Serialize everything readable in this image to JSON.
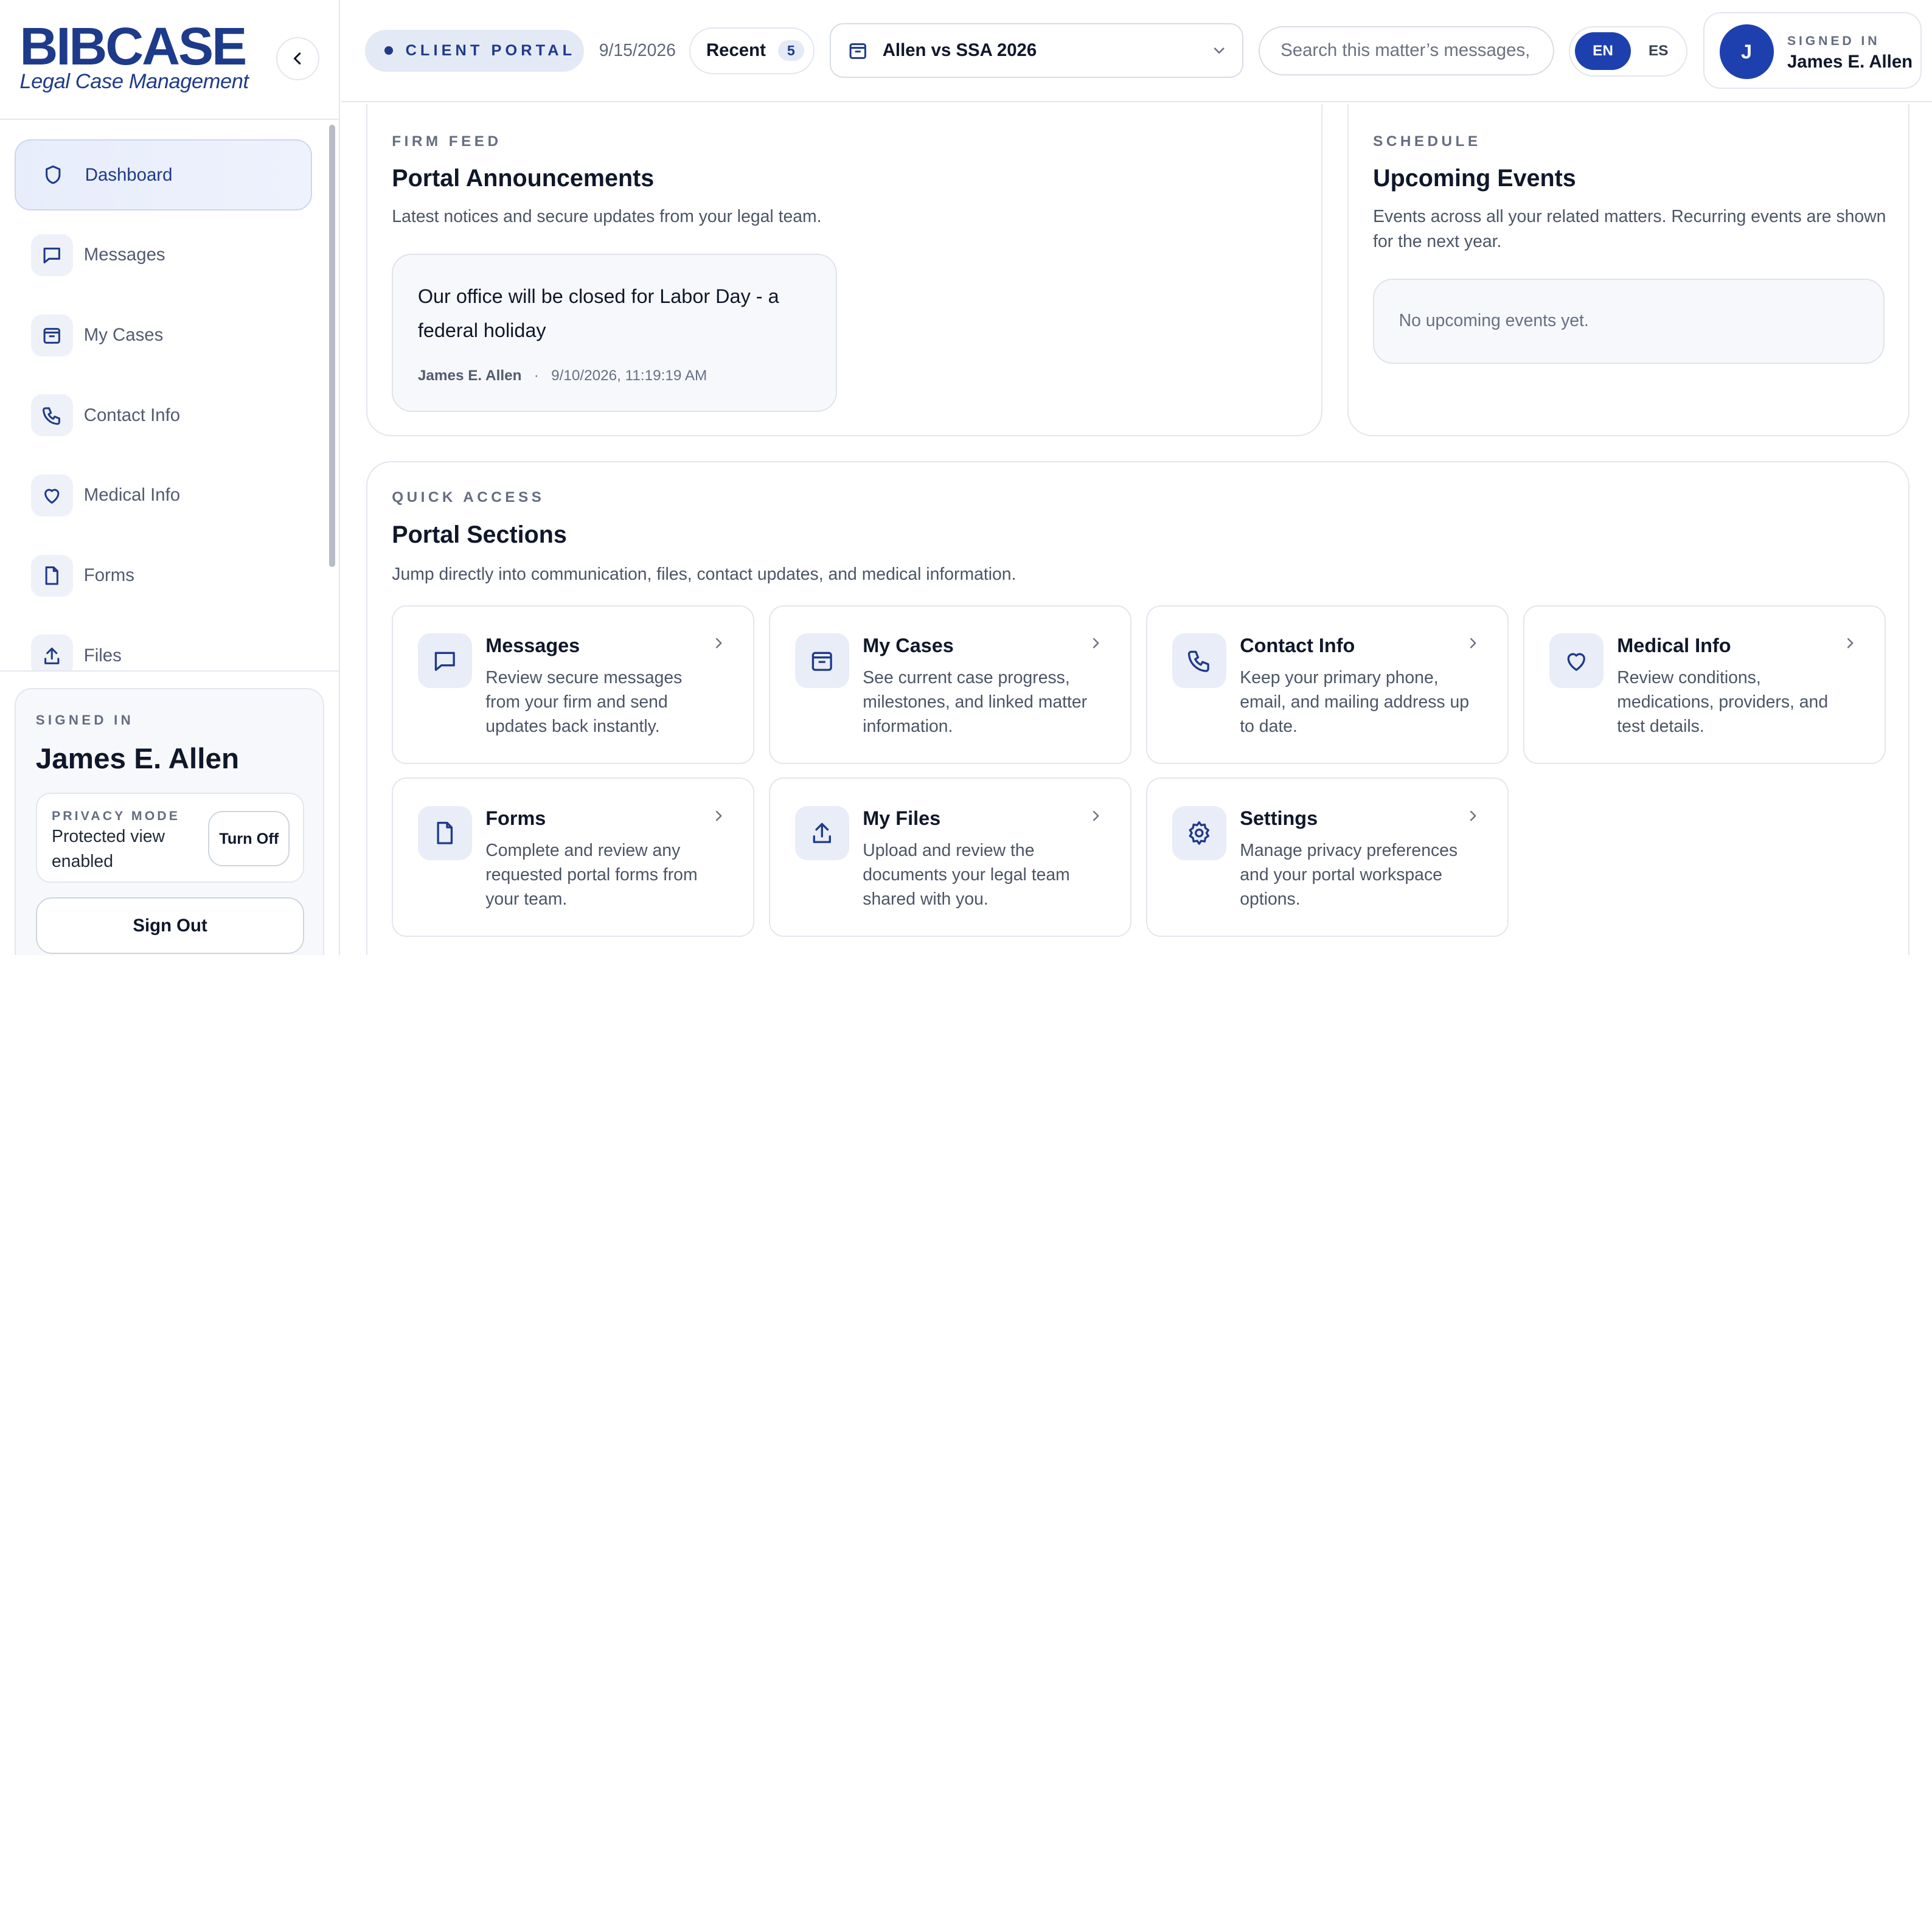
{
  "brand": {
    "logo_word": "BIBCASE",
    "tagline": "Legal Case Management"
  },
  "sidebar": {
    "items": [
      {
        "label": "Dashboard",
        "icon": "shield-icon",
        "active": true
      },
      {
        "label": "Messages",
        "icon": "message-icon"
      },
      {
        "label": "My Cases",
        "icon": "case-icon"
      },
      {
        "label": "Contact Info",
        "icon": "phone-icon"
      },
      {
        "label": "Medical Info",
        "icon": "heart-icon"
      },
      {
        "label": "Forms",
        "icon": "document-icon"
      },
      {
        "label": "Files",
        "icon": "upload-icon"
      }
    ],
    "account": {
      "label": "SIGNED IN",
      "name": "James E. Allen",
      "privacy_label": "PRIVACY MODE",
      "privacy_status": "Protected view enabled",
      "turn_off_label": "Turn Off",
      "sign_out_label": "Sign Out"
    }
  },
  "topbar": {
    "portal_label": "CLIENT PORTAL",
    "date": "9/15/2026",
    "recent_label": "Recent",
    "recent_count": "5",
    "matter": "Allen vs SSA 2026",
    "search_placeholder": "Search this matter’s messages,",
    "languages": [
      "EN",
      "ES"
    ],
    "active_language": "EN",
    "user_initial": "J",
    "user_label": "SIGNED IN",
    "user_name": "James E. Allen"
  },
  "feed": {
    "eyebrow": "FIRM FEED",
    "title": "Portal Announcements",
    "description": "Latest notices and secure updates from your legal team.",
    "announcement": {
      "text": "Our office will be closed for Labor Day - a federal holiday",
      "author": "James E. Allen",
      "timestamp": "9/10/2026, 11:19:19 AM"
    }
  },
  "schedule": {
    "eyebrow": "SCHEDULE",
    "title": "Upcoming Events",
    "description": "Events across all your related matters. Recurring events are shown for the next year.",
    "empty_text": "No upcoming events yet."
  },
  "quick_access": {
    "eyebrow": "QUICK ACCESS",
    "title": "Portal Sections",
    "description": "Jump directly into communication, files, contact updates, and medical information.",
    "tiles": [
      {
        "title": "Messages",
        "description": "Review secure messages from your firm and send updates back instantly.",
        "icon": "message-icon"
      },
      {
        "title": "My Cases",
        "description": "See current case progress, milestones, and linked matter information.",
        "icon": "case-icon"
      },
      {
        "title": "Contact Info",
        "description": "Keep your primary phone, email, and mailing address up to date.",
        "icon": "phone-icon"
      },
      {
        "title": "Medical Info",
        "description": "Review conditions, medications, providers, and test details.",
        "icon": "heart-icon"
      },
      {
        "title": "Forms",
        "description": "Complete and review any requested portal forms from your team.",
        "icon": "document-icon"
      },
      {
        "title": "My Files",
        "description": "Upload and review the documents your legal team shared with you.",
        "icon": "upload-icon"
      },
      {
        "title": "Settings",
        "description": "Manage privacy preferences and your portal workspace options.",
        "icon": "gear-icon"
      }
    ]
  },
  "colors": {
    "brand": "#1e3a8a",
    "accent": "#1e40af",
    "surface": "#f7f8fb",
    "border": "#e2e6ee"
  }
}
